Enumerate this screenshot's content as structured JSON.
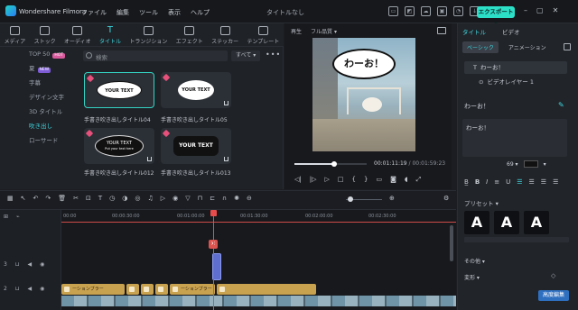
{
  "app": {
    "name": "Wondershare Filmora",
    "menu": [
      "ファイル",
      "編集",
      "ツール",
      "表示",
      "ヘルプ"
    ],
    "doc_title": "タイトルなし",
    "export_label": "エクスポート",
    "accent": "#2ce0c8"
  },
  "media": {
    "tabs": [
      "メディア",
      "ストック",
      "オーディオ",
      "タイトル",
      "トランジション",
      "エフェクト",
      "ステッカー",
      "テンプレート"
    ],
    "active_tab": "タイトル",
    "nav": [
      {
        "label": "TOP 50",
        "badge": "HOT"
      },
      {
        "label": "夏",
        "badge": "NEW"
      },
      {
        "label": "字幕"
      },
      {
        "label": "デザイン文字"
      },
      {
        "label": "3D タイトル"
      },
      {
        "label": "吹き出し",
        "active": true
      },
      {
        "label": "ローサード"
      }
    ],
    "search_placeholder": "検索",
    "filter": "すべて",
    "cards": [
      {
        "label": "手書き吹き出しタイトル04",
        "text": "YOUR TEXT",
        "selected": true
      },
      {
        "label": "手書き吹き出しタイトル05",
        "text": "YOUR TEXT"
      },
      {
        "label": "手書き吹き出しタイトル012",
        "text": "YOUR TEXT"
      },
      {
        "label": "手書き吹き出しタイトル013",
        "text": "YOUR TEXT"
      }
    ],
    "card2_sub": "Put your text here"
  },
  "preview": {
    "tabs": [
      "再生",
      "フル品質"
    ],
    "overlay_text": "わーお！",
    "progress": 0.55,
    "time_current": "00:01:11:19",
    "time_total": "00:01:59:23"
  },
  "inspector": {
    "tabs": [
      "タイトル",
      "ビデオ"
    ],
    "subtabs": [
      "ベーシック",
      "アニメーション"
    ],
    "layers": [
      "わーお！",
      "ビデオレイヤー 1"
    ],
    "text_label": "わーお！",
    "text_value": "わーお！",
    "font_size": "69",
    "preset_label": "プリセット",
    "preset_glyph": "A",
    "other_label": "その他",
    "transform_label": "変形",
    "advanced_button": "高度編集"
  },
  "timeline": {
    "ticks": [
      "00:00",
      "00:00:30:00",
      "00:01:00:00",
      "00:01:30:00",
      "00:02:00:00",
      "00:02:30:00"
    ],
    "text_clip_label": "ーションブラー",
    "track_numbers": [
      "3",
      "2"
    ]
  }
}
